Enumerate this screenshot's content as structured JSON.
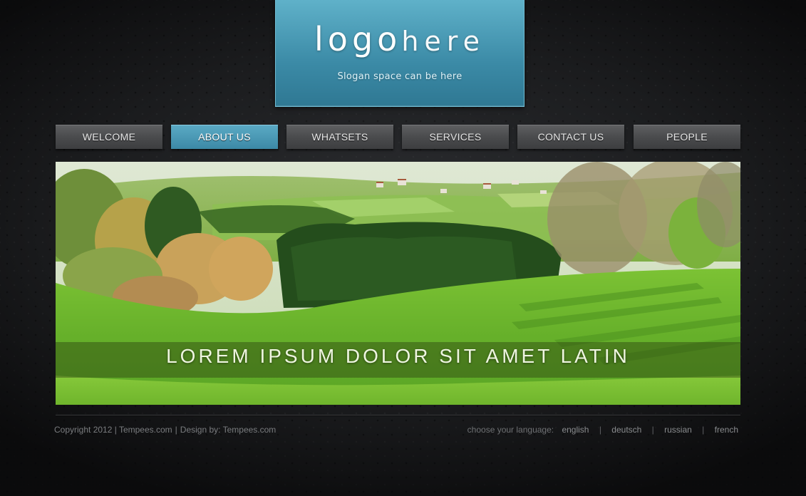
{
  "logo": {
    "bold": "logo",
    "light": "here",
    "slogan": "Slogan space can be here"
  },
  "nav": {
    "items": [
      {
        "label": "WELCOME",
        "active": false
      },
      {
        "label": "ABOUT US",
        "active": true
      },
      {
        "label": "WHATSETS",
        "active": false
      },
      {
        "label": "SERVICES",
        "active": false
      },
      {
        "label": "CONTACT US",
        "active": false
      },
      {
        "label": "PEOPLE",
        "active": false
      }
    ]
  },
  "banner": {
    "caption": "LOREM IPSUM DOLOR SIT AMET LATIN"
  },
  "footer": {
    "copyright": "Copyright 2012 | Tempees.com",
    "separator": "|",
    "design": "Design by: Tempees.com",
    "language_label": "choose your language:",
    "languages": [
      "english",
      "deutsch",
      "russian",
      "french"
    ],
    "language_separator": "|"
  },
  "colors": {
    "accent": "#3c89a6",
    "background": "#1a1b1d",
    "nav_inactive": "#4a4b4d",
    "footer_text": "#7a7c7f"
  }
}
